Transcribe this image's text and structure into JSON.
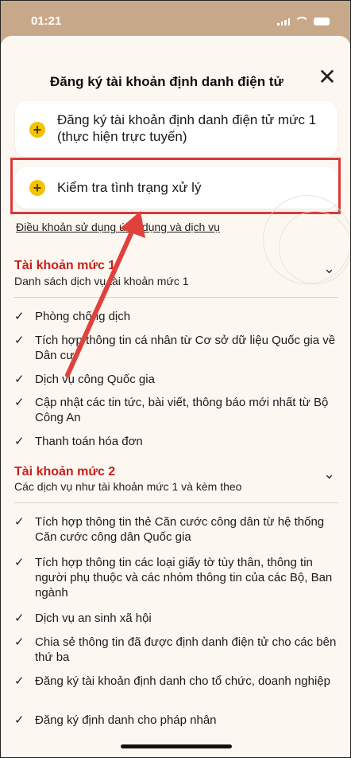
{
  "status_bar": {
    "time": "01:21"
  },
  "header": {
    "title": "Đăng ký tài khoản định danh điện tử",
    "close_symbol": "✕"
  },
  "options": [
    {
      "label": "Đăng ký tài khoản định danh điện tử mức 1 (thực hiện trực tuyến)"
    },
    {
      "label": "Kiểm tra tình trạng xử lý"
    }
  ],
  "plus_symbol": "+",
  "terms_link": "Điều khoản sử dụng ứng dụng và dịch vụ",
  "sections": [
    {
      "title": "Tài khoản mức 1",
      "subtitle": "Danh sách dịch vụ tài khoản mức 1",
      "items": [
        "Phòng chống dịch",
        "Tích hợp thông tin cá nhân từ Cơ sở dữ liệu Quốc gia về Dân cư",
        "Dịch vụ công Quốc gia",
        "Cập nhật các tin tức, bài viết, thông báo mới nhất từ Bộ Công An",
        "Thanh toán hóa đơn"
      ]
    },
    {
      "title": "Tài khoản mức 2",
      "subtitle": "Các dịch vụ như tài khoản mức 1 và kèm theo",
      "items": [
        "Tích hợp thông tin thẻ Căn cước công dân từ hệ thống Căn cước công dân Quốc gia",
        "Tích hợp thông tin các loại giấy tờ tùy thân, thông tin người phụ thuộc và các nhóm thông tin của các Bộ, Ban ngành",
        "Dịch vụ an sinh xã hội",
        "Chia sẻ thông tin đã được định danh điện tử cho các bên thứ ba",
        "Đăng ký tài khoản định danh cho tổ chức, doanh nghiệp",
        "Đăng ký định danh cho pháp nhân"
      ]
    }
  ],
  "check_symbol": "✓",
  "chevron_symbol": "⌄",
  "colors": {
    "accent_red": "#c4201c",
    "plus_yellow": "#f2c300",
    "highlight_red": "#d93a3a"
  }
}
